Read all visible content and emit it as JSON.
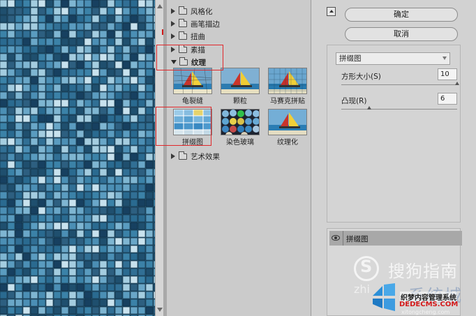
{
  "gallery": {
    "categories": [
      {
        "label": "风格化",
        "expanded": false
      },
      {
        "label": "画笔描边",
        "expanded": false
      },
      {
        "label": "扭曲",
        "expanded": false
      },
      {
        "label": "素描",
        "expanded": false
      },
      {
        "label": "纹理",
        "expanded": true
      },
      {
        "label": "艺术效果",
        "expanded": false
      }
    ],
    "texture_filters": [
      {
        "label": "龟裂缝",
        "selected": false
      },
      {
        "label": "颗粒",
        "selected": false
      },
      {
        "label": "马赛克拼贴",
        "selected": false
      },
      {
        "label": "拼缀图",
        "selected": true
      },
      {
        "label": "染色玻璃",
        "selected": false
      },
      {
        "label": "纹理化",
        "selected": false
      }
    ]
  },
  "actions": {
    "ok_label": "确定",
    "cancel_label": "取消"
  },
  "settings": {
    "filter_select": "拼缀图",
    "params": [
      {
        "label": "方形大小(S)",
        "value": "10",
        "fraction": 1.0
      },
      {
        "label": "凸现(R)",
        "value": "6",
        "fraction": 0.24
      }
    ]
  },
  "layers": {
    "items": [
      {
        "name": "拼缀图",
        "visible": true
      }
    ]
  },
  "watermarks": {
    "sogou": "搜狗指南",
    "sogou_domain": "zhi",
    "xitong": "系统城",
    "xitong_domain": "xitongcheng.com",
    "dede_title": "织梦内容管理系统",
    "dede_domain": "DEDECMS.COM"
  },
  "colors": {
    "highlight": "#e0272a",
    "tile_base": "#2e6a8f",
    "panel_bg": "#cbcbcb"
  }
}
